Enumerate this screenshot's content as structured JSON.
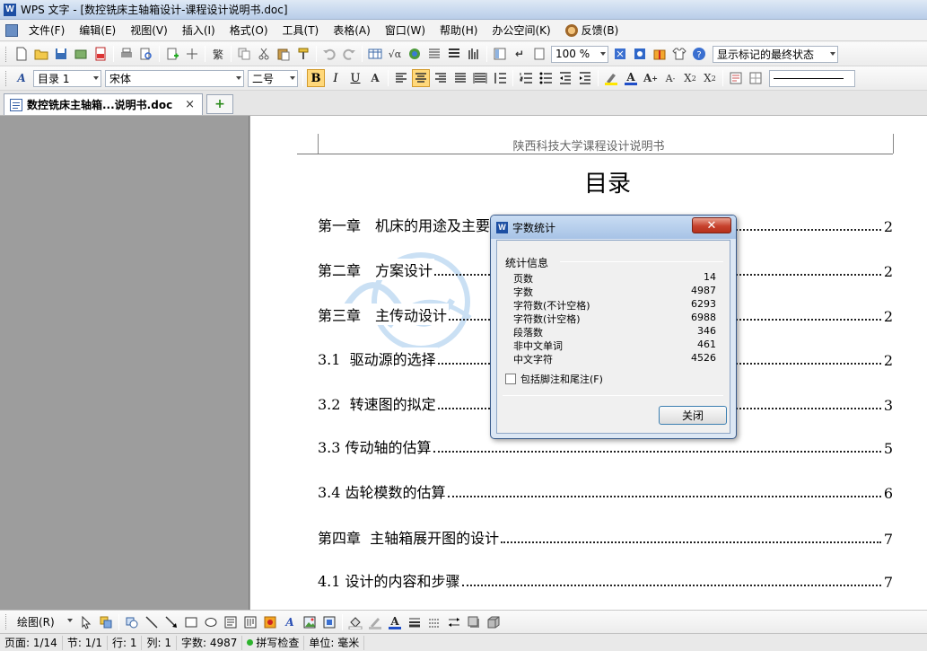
{
  "window": {
    "title": "WPS 文字 - [数控铣床主轴箱设计-课程设计说明书.doc]",
    "logo": "W"
  },
  "menu": {
    "items": [
      "文件(F)",
      "编辑(E)",
      "视图(V)",
      "插入(I)",
      "格式(O)",
      "工具(T)",
      "表格(A)",
      "窗口(W)",
      "帮助(H)",
      "办公空间(K)",
      "反馈(B)"
    ]
  },
  "toolbar": {
    "zoom": "100 %",
    "markup_state": "显示标记的最终状态"
  },
  "format_toolbar": {
    "style": "目录 1",
    "font": "宋体",
    "size": "二号",
    "bold": "B",
    "italic": "I",
    "underline": "U"
  },
  "tabs": {
    "active_doc": "数控铣床主轴箱...说明书.doc",
    "close": "×",
    "new": "+"
  },
  "document": {
    "header": "陕西科技大学课程设计说明书",
    "toc_title": "目录",
    "toc": [
      {
        "label": "第一章　机床的用途及主要参数",
        "page": "2"
      },
      {
        "label": "第二章　方案设计",
        "page": "2"
      },
      {
        "label": "第三章　主传动设计",
        "page": "2"
      },
      {
        "label": "3.1  驱动源的选择",
        "page": "2"
      },
      {
        "label": "3.2  转速图的拟定",
        "page": "3"
      },
      {
        "label": "3.3 传动轴的估算",
        "page": "5"
      },
      {
        "label": "3.4 齿轮模数的估算",
        "page": "6"
      },
      {
        "label": "第四章  主轴箱展开图的设计",
        "page": "7"
      },
      {
        "label": "4.1 设计的内容和步骤",
        "page": "7"
      }
    ]
  },
  "dialog": {
    "title": "字数统计",
    "group": "统计信息",
    "stats": [
      {
        "name": "页数",
        "value": "14"
      },
      {
        "name": "字数",
        "value": "4987"
      },
      {
        "name": "字符数(不计空格)",
        "value": "6293"
      },
      {
        "name": "字符数(计空格)",
        "value": "6988"
      },
      {
        "name": "段落数",
        "value": "346"
      },
      {
        "name": "非中文单词",
        "value": "461"
      },
      {
        "name": "中文字符",
        "value": "4526"
      }
    ],
    "checkbox": "包括脚注和尾注(F)",
    "close_button": "关闭",
    "close_x": "✕"
  },
  "drawbar": {
    "label": "绘图(R)"
  },
  "status": {
    "page": "页面: 1/14",
    "section": "节: 1/1",
    "row": "行: 1",
    "col": "列: 1",
    "words": "字数: 4987",
    "spell": "拼写检查",
    "unit": "单位: 毫米"
  }
}
